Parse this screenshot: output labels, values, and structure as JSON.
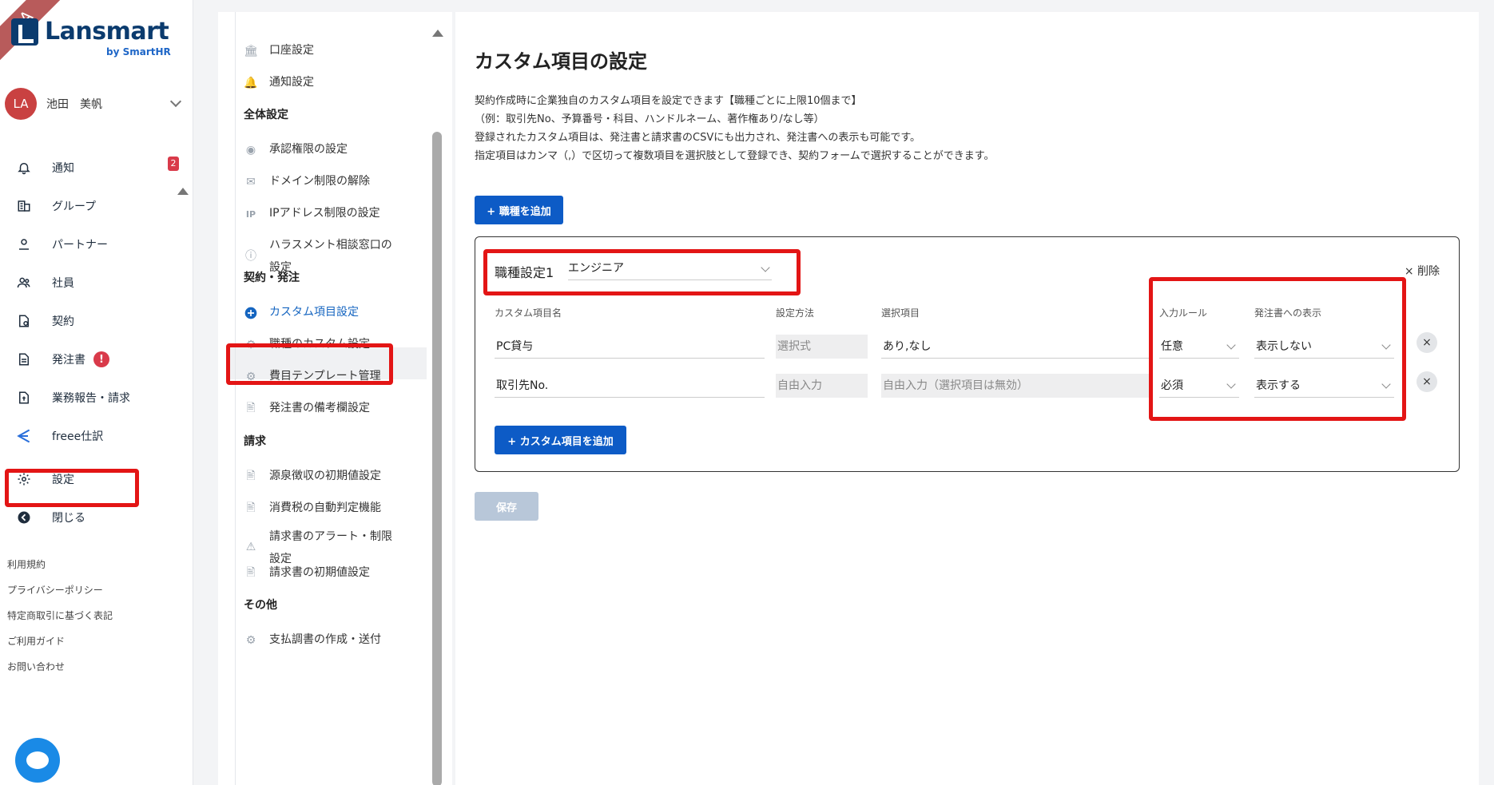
{
  "brand": {
    "name": "Lansmart",
    "sub": "by SmartHR",
    "ribbon": "QA"
  },
  "user": {
    "initials": "LA",
    "name": "池田　美帆"
  },
  "nav": [
    {
      "label": "通知",
      "icon": "bell-icon",
      "badge": "2"
    },
    {
      "label": "グループ",
      "icon": "building-icon"
    },
    {
      "label": "パートナー",
      "icon": "person-icon"
    },
    {
      "label": "社員",
      "icon": "people-icon"
    },
    {
      "label": "契約",
      "icon": "contract-icon"
    },
    {
      "label": "発注書",
      "icon": "document-icon",
      "alert": "!"
    },
    {
      "label": "業務報告・請求",
      "icon": "invoice-icon"
    },
    {
      "label": "freee仕訳",
      "icon": "freee-icon"
    },
    {
      "label": "設定",
      "icon": "gear-icon"
    },
    {
      "label": "閉じる",
      "icon": "arrow-left-circle-icon"
    }
  ],
  "footer_links": [
    "利用規約",
    "プライバシーポリシー",
    "特定商取引に基づく表記",
    "ご利用ガイド",
    "お問い合わせ"
  ],
  "settings_nav": {
    "items_top": [
      "口座設定",
      "通知設定"
    ],
    "group_general": "全体設定",
    "general": [
      "承認権限の設定",
      "ドメイン制限の解除",
      "IPアドレス制限の設定",
      "ハラスメント相談窓口の設定"
    ],
    "group_contract": "契約・発注",
    "contract": [
      "カスタム項目設定",
      "職種のカスタム設定",
      "費目テンプレート管理",
      "発注書の備考欄設定"
    ],
    "group_invoice": "請求",
    "invoice": [
      "源泉徴収の初期値設定",
      "消費税の自動判定機能",
      "請求書のアラート・制限設定",
      "請求書の初期値設定"
    ],
    "group_other": "その他",
    "other": [
      "支払調書の作成・送付"
    ]
  },
  "main": {
    "title": "カスタム項目の設定",
    "description": [
      "契約作成時に企業独自のカスタム項目を設定できます【職種ごとに上限10個まで】",
      "（例：取引先No、予算番号・科目、ハンドルネーム、著作権あり/なし等）",
      "登録されたカスタム項目は、発注書と請求書のCSVにも出力され、発注書への表示も可能です。",
      "指定項目はカンマ（,）で区切って複数項目を選択肢として登録でき、契約フォームで選択することができます。"
    ],
    "add_job_button": "+ 職種を追加",
    "job": {
      "label": "職種設定1",
      "value": "エンジニア",
      "delete": "× 削除",
      "columns": [
        "カスタム項目名",
        "設定方法",
        "選択項目",
        "入力ルール",
        "発注書への表示"
      ],
      "rows": [
        {
          "name": "PC貸与",
          "method": "選択式",
          "options": "あり,なし",
          "rule": "任意",
          "display": "表示しない"
        },
        {
          "name": "取引先No.",
          "method": "自由入力",
          "options": "自由入力（選択項目は無効）",
          "rule": "必須",
          "display": "表示する"
        }
      ],
      "add_item_button": "+ カスタム項目を追加"
    },
    "save_button": "保存"
  }
}
